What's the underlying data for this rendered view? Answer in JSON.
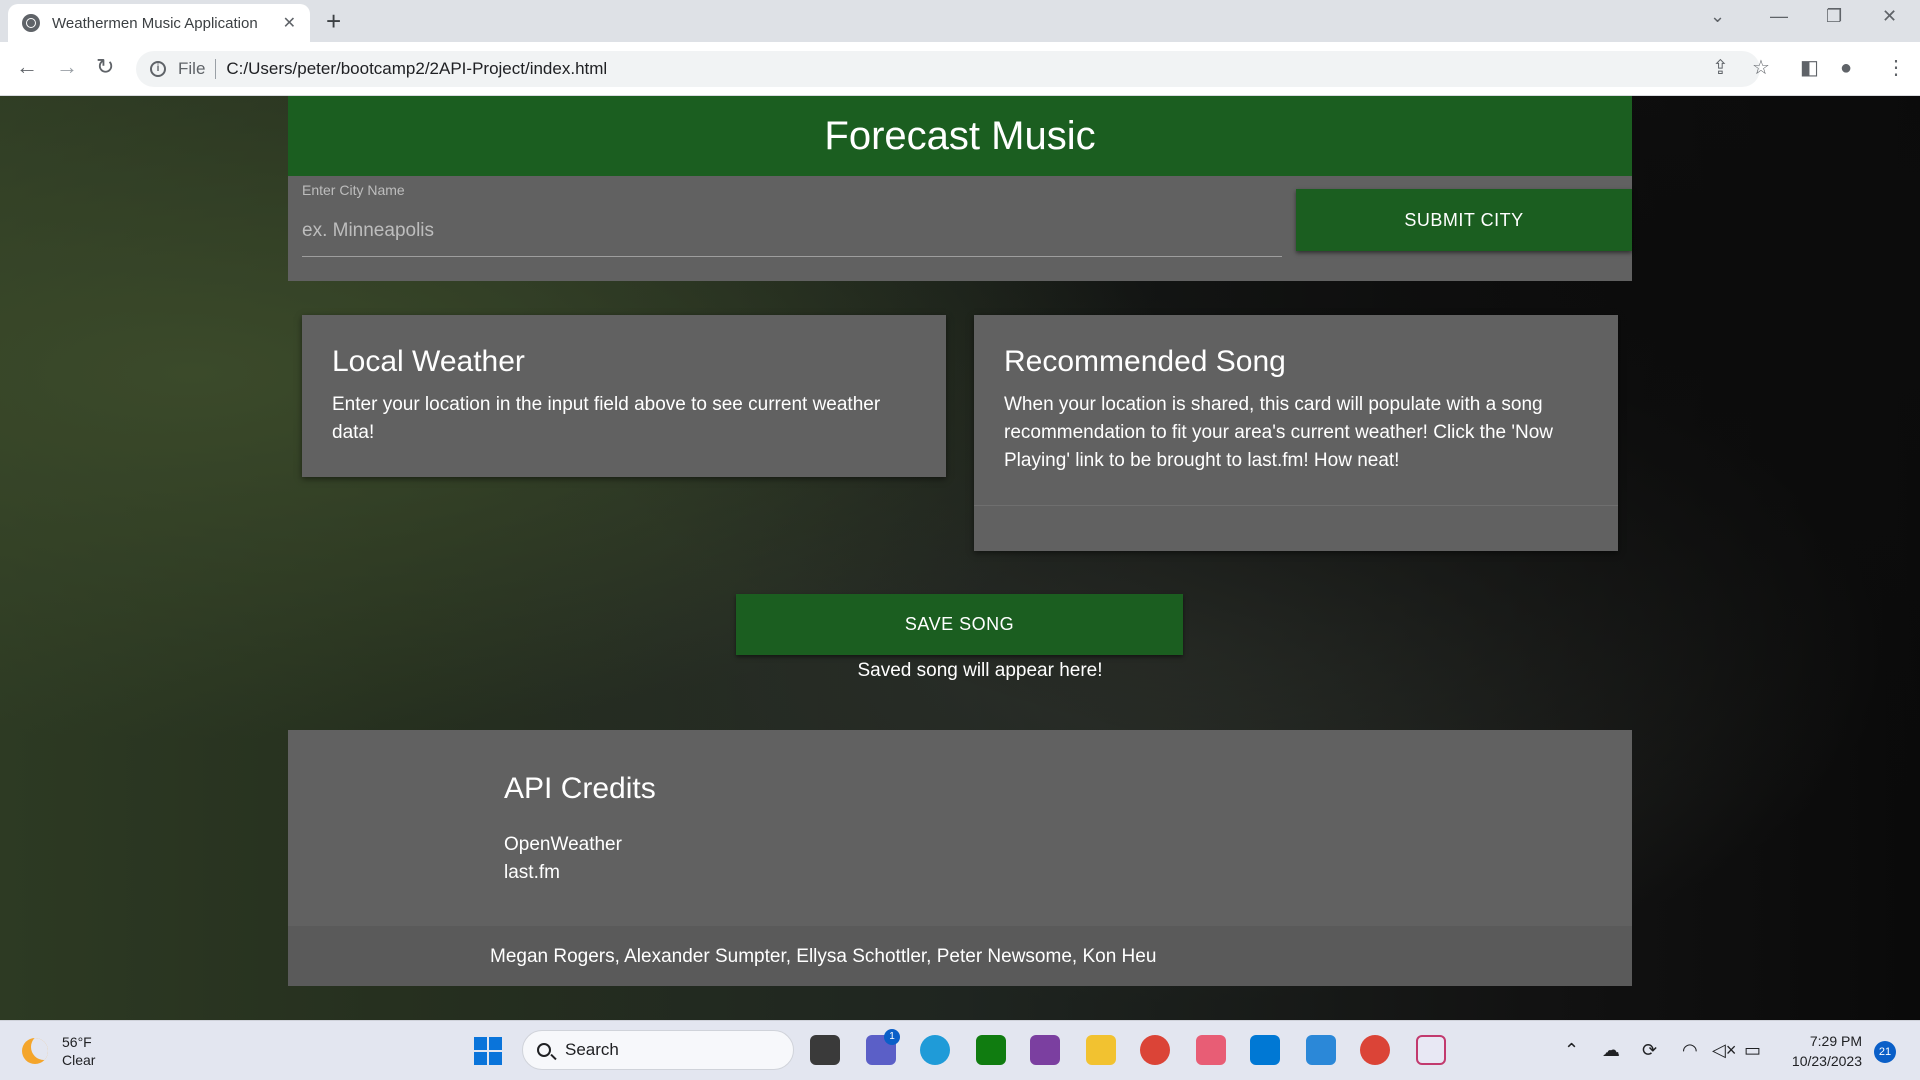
{
  "browser": {
    "tab_title": "Weathermen Music Application",
    "tab_close": "✕",
    "new_tab": "+",
    "address_scheme": "File",
    "address_url": "C:/Users/peter/bootcamp2/2API-Project/index.html"
  },
  "page": {
    "title": "Forecast Music",
    "city_label": "Enter City Name",
    "city_placeholder": "ex. Minneapolis",
    "submit_button": "SUBMIT CITY",
    "weather_card": {
      "title": "Local Weather",
      "body": "Enter your location in the input field above to see current weather data!"
    },
    "song_card": {
      "title": "Recommended Song",
      "body": "When your location is shared, this card will populate with a song recommendation to fit your area's current weather! Click the 'Now Playing' link to be brought to last.fm! How neat!"
    },
    "save_button": "SAVE SONG",
    "saved_text": "Saved song will appear here!",
    "footer": {
      "heading": "API Credits",
      "credits": [
        "OpenWeather",
        "last.fm"
      ],
      "authors": "Megan Rogers, Alexander Sumpter, Ellysa Schottler, Peter Newsome, Kon Heu"
    }
  },
  "taskbar": {
    "weather_temp": "56°F",
    "weather_cond": "Clear",
    "search_label": "Search",
    "time": "7:29 PM",
    "date": "10/23/2023",
    "notification_count": "21",
    "chat_badge": "1"
  },
  "colors": {
    "header_green": "#1b5e20",
    "panel_gray": "#616161"
  }
}
